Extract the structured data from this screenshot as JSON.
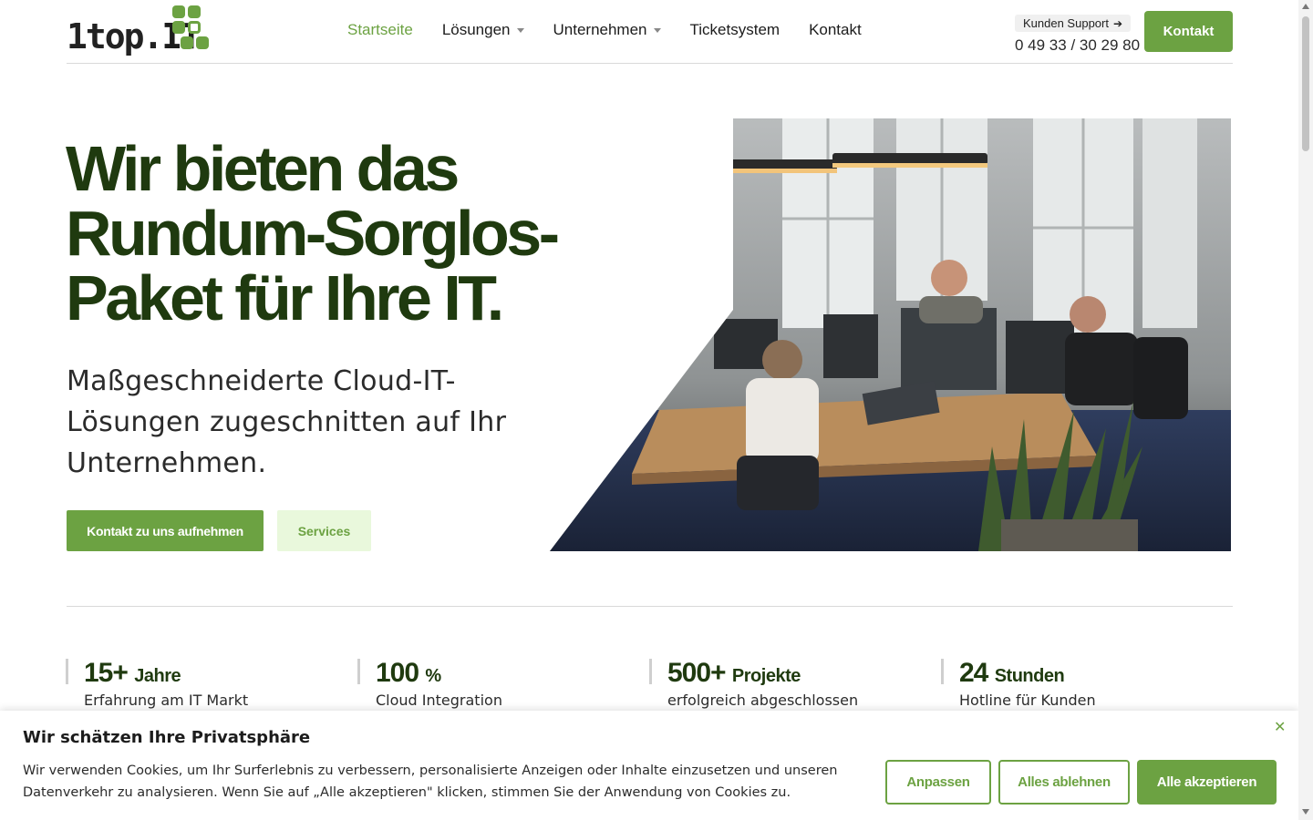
{
  "brand": {
    "logo_text": "1top.",
    "logo_text_accent": "IT",
    "accent_color": "#6ca242",
    "dark_green": "#1f3a0f"
  },
  "nav": {
    "items": [
      {
        "label": "Startseite",
        "active": true,
        "dropdown": false
      },
      {
        "label": "Lösungen",
        "active": false,
        "dropdown": true
      },
      {
        "label": "Unternehmen",
        "active": false,
        "dropdown": true
      },
      {
        "label": "Ticketsystem",
        "active": false,
        "dropdown": false
      },
      {
        "label": "Kontakt",
        "active": false,
        "dropdown": false
      }
    ]
  },
  "support": {
    "badge_label": "Kunden Support",
    "phone": "0 49 33 / 30 29 80"
  },
  "header": {
    "contact_button": "Kontakt"
  },
  "hero": {
    "title": "Wir bieten das Rundum-Sorglos-Paket für Ihre IT.",
    "subtitle": "Maßgeschneiderte Cloud-IT-Lösungen zugeschnitten auf Ihr Unternehmen.",
    "primary_button": "Kontakt zu uns aufnehmen",
    "secondary_button": "Services",
    "image_alt": "office-photo"
  },
  "stats": [
    {
      "value": "15+",
      "unit": "Jahre",
      "label": "Erfahrung am IT Markt"
    },
    {
      "value": "100",
      "unit": "%",
      "label": "Cloud Integration"
    },
    {
      "value": "500+",
      "unit": "Projekte",
      "label": "erfolgreich abgeschlossen"
    },
    {
      "value": "24",
      "unit": "Stunden",
      "label": "Hotline für Kunden"
    }
  ],
  "cookie": {
    "title": "Wir schätzen Ihre Privatsphäre",
    "text": "Wir verwenden Cookies, um Ihr Surferlebnis zu verbessern, personalisierte Anzeigen oder Inhalte einzusetzen und unseren Datenverkehr zu analysieren. Wenn Sie auf „Alle akzeptieren\" klicken, stimmen Sie der Anwendung von Cookies zu.",
    "customize_button": "Anpassen",
    "reject_button": "Alles ablehnen",
    "accept_button": "Alle akzeptieren",
    "close_icon": "close-icon"
  }
}
